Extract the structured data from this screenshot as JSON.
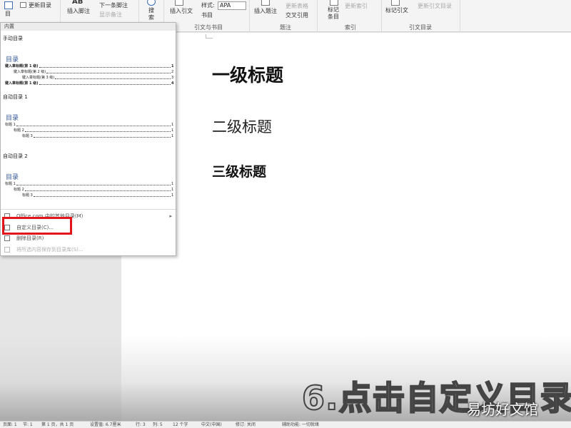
{
  "ribbon": {
    "update_toc": "更新目录",
    "ab_glyph": "AB",
    "insert_footnote": "插入脚注",
    "next_footnote": "下一条脚注",
    "show_notes": "显示备注",
    "search": "搜\n索",
    "insert_citation": "插入引文",
    "style_label": "样式:",
    "style_value": "APA",
    "bibliography": "书目",
    "insert_caption": "插入题注",
    "update_table": "更新表格",
    "cross_reference": "交叉引用",
    "mark_entry": "标记\n条目",
    "update_index": "更新索引",
    "mark_citation": "标记引文",
    "update_table_of_authorities": "更新引文目录",
    "group_citations": "引文与书目",
    "group_captions": "题注",
    "group_index": "索引",
    "group_authorities": "引文目录"
  },
  "dropdown": {
    "section_header": "内置",
    "manual_toc": "手动目录",
    "auto_toc_1": "自动目录 1",
    "auto_toc_2": "自动目录 2",
    "toc_heading": "目录",
    "manual_lines": [
      {
        "text": "键入章标题(第 1 级)",
        "page": "1"
      },
      {
        "text": "键入章标题(第 2 级)",
        "page": "2"
      },
      {
        "text": "键入章标题(第 3 级)",
        "page": "3"
      },
      {
        "text": "键入章标题(第 1 级)",
        "page": "4"
      }
    ],
    "auto_lines": [
      {
        "text": "标题 1",
        "page": "1"
      },
      {
        "text": "标题 2",
        "page": "1"
      },
      {
        "text": "标题 3",
        "page": "1"
      }
    ],
    "menu_more": "Office.com 中的其他目录(M)",
    "menu_custom": "自定义目录(C)...",
    "menu_remove": "删除目录(R)",
    "menu_save": "将所选内容保存到目录库(S)..."
  },
  "document": {
    "heading1": "一级标题",
    "heading2": "二级标题",
    "heading3": "三级标题"
  },
  "overlay": {
    "caption": "6.点击自定义目录",
    "watermark": "易坊好文馆"
  },
  "statusbar": {
    "page": "页面: 1",
    "section": "节: 1",
    "page_of": "第 1 页，共 1 页",
    "position": "设置值: 6.7厘米",
    "line": "行: 3",
    "column": "列: 5",
    "words": "12 个字",
    "language": "中文(中国)",
    "track_changes": "修订: 关闭",
    "accessibility": "辅助功能: 一切就绪"
  },
  "colors": {
    "highlight": "#e3141b",
    "toc_heading": "#2f5597"
  }
}
